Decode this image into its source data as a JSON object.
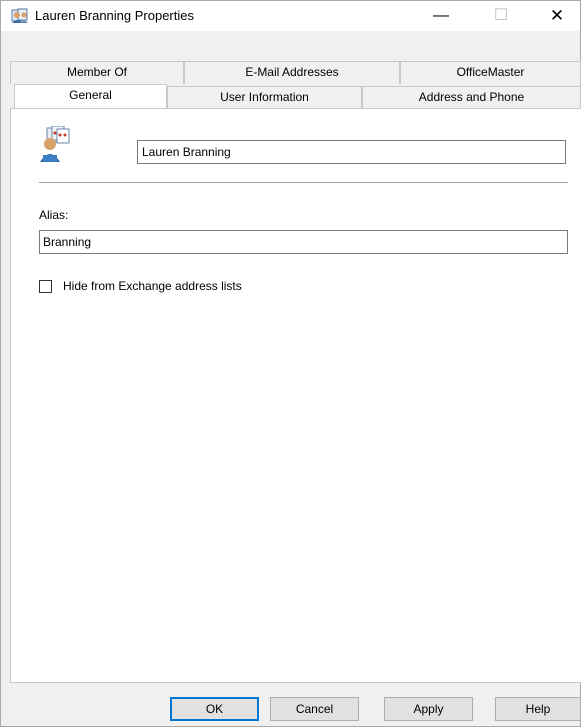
{
  "window": {
    "title": "Lauren Branning Properties",
    "controls": {
      "minimize": "—",
      "maximize": "☐",
      "close": "✕"
    }
  },
  "tabs": {
    "row1": [
      {
        "label": "Member Of"
      },
      {
        "label": "E-Mail Addresses"
      },
      {
        "label": "OfficeMaster"
      }
    ],
    "row2": [
      {
        "label": "General",
        "active": true
      },
      {
        "label": "User Information"
      },
      {
        "label": "Address and Phone"
      }
    ]
  },
  "general": {
    "icon": "user-group-icon",
    "display_name": "Lauren Branning",
    "alias_label": "Alias:",
    "alias_value": "Branning",
    "hide_checkbox_label": "Hide from Exchange address lists",
    "hide_checked": false
  },
  "buttons": {
    "ok": "OK",
    "cancel": "Cancel",
    "apply": "Apply",
    "help": "Help"
  },
  "colors": {
    "focus_border": "#0078d7",
    "dialog_bg": "#f0f0f0",
    "panel_bg": "#ffffff"
  }
}
